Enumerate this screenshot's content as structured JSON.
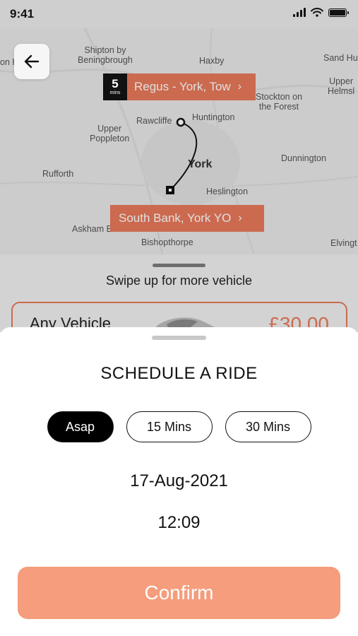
{
  "status_bar": {
    "time": "9:41"
  },
  "map": {
    "places": {
      "shipton": "Shipton by\nBeningbrough",
      "haxby": "Haxby",
      "sand_hutton": "Sand Hu",
      "upper_helmsley": "Upper\nHelmsl",
      "stockton": "Stockton on\nthe Forest",
      "rawcliffe": "Rawcliffe",
      "huntington": "Huntington",
      "upper_poppleton": "Upper\nPoppleton",
      "york": "York",
      "dunnington": "Dunnington",
      "rufforth": "Rufforth",
      "heslington": "Heslington",
      "askham": "Askham B",
      "bishopthorpe": "Bishopthorpe",
      "elvington": "Elvingt",
      "left_edge": "on H"
    },
    "pickup_label": "Regus - York, Tow",
    "dropoff_label": "South Bank, York YO",
    "eta_value": "5",
    "eta_unit": "mins"
  },
  "underlying_sheet": {
    "swipe_hint": "Swipe up for more vehicle",
    "vehicle_name": "Any Vehicle",
    "vehicle_price": "£30.00"
  },
  "schedule": {
    "title": "SCHEDULE A RIDE",
    "options": [
      "Asap",
      "15 Mins",
      "30 Mins"
    ],
    "selected": "Asap",
    "date": "17-Aug-2021",
    "time": "12:09",
    "confirm_label": "Confirm"
  },
  "colors": {
    "accent": "#e8795a",
    "confirm": "#f59d7c",
    "selected_chip": "#000000"
  }
}
